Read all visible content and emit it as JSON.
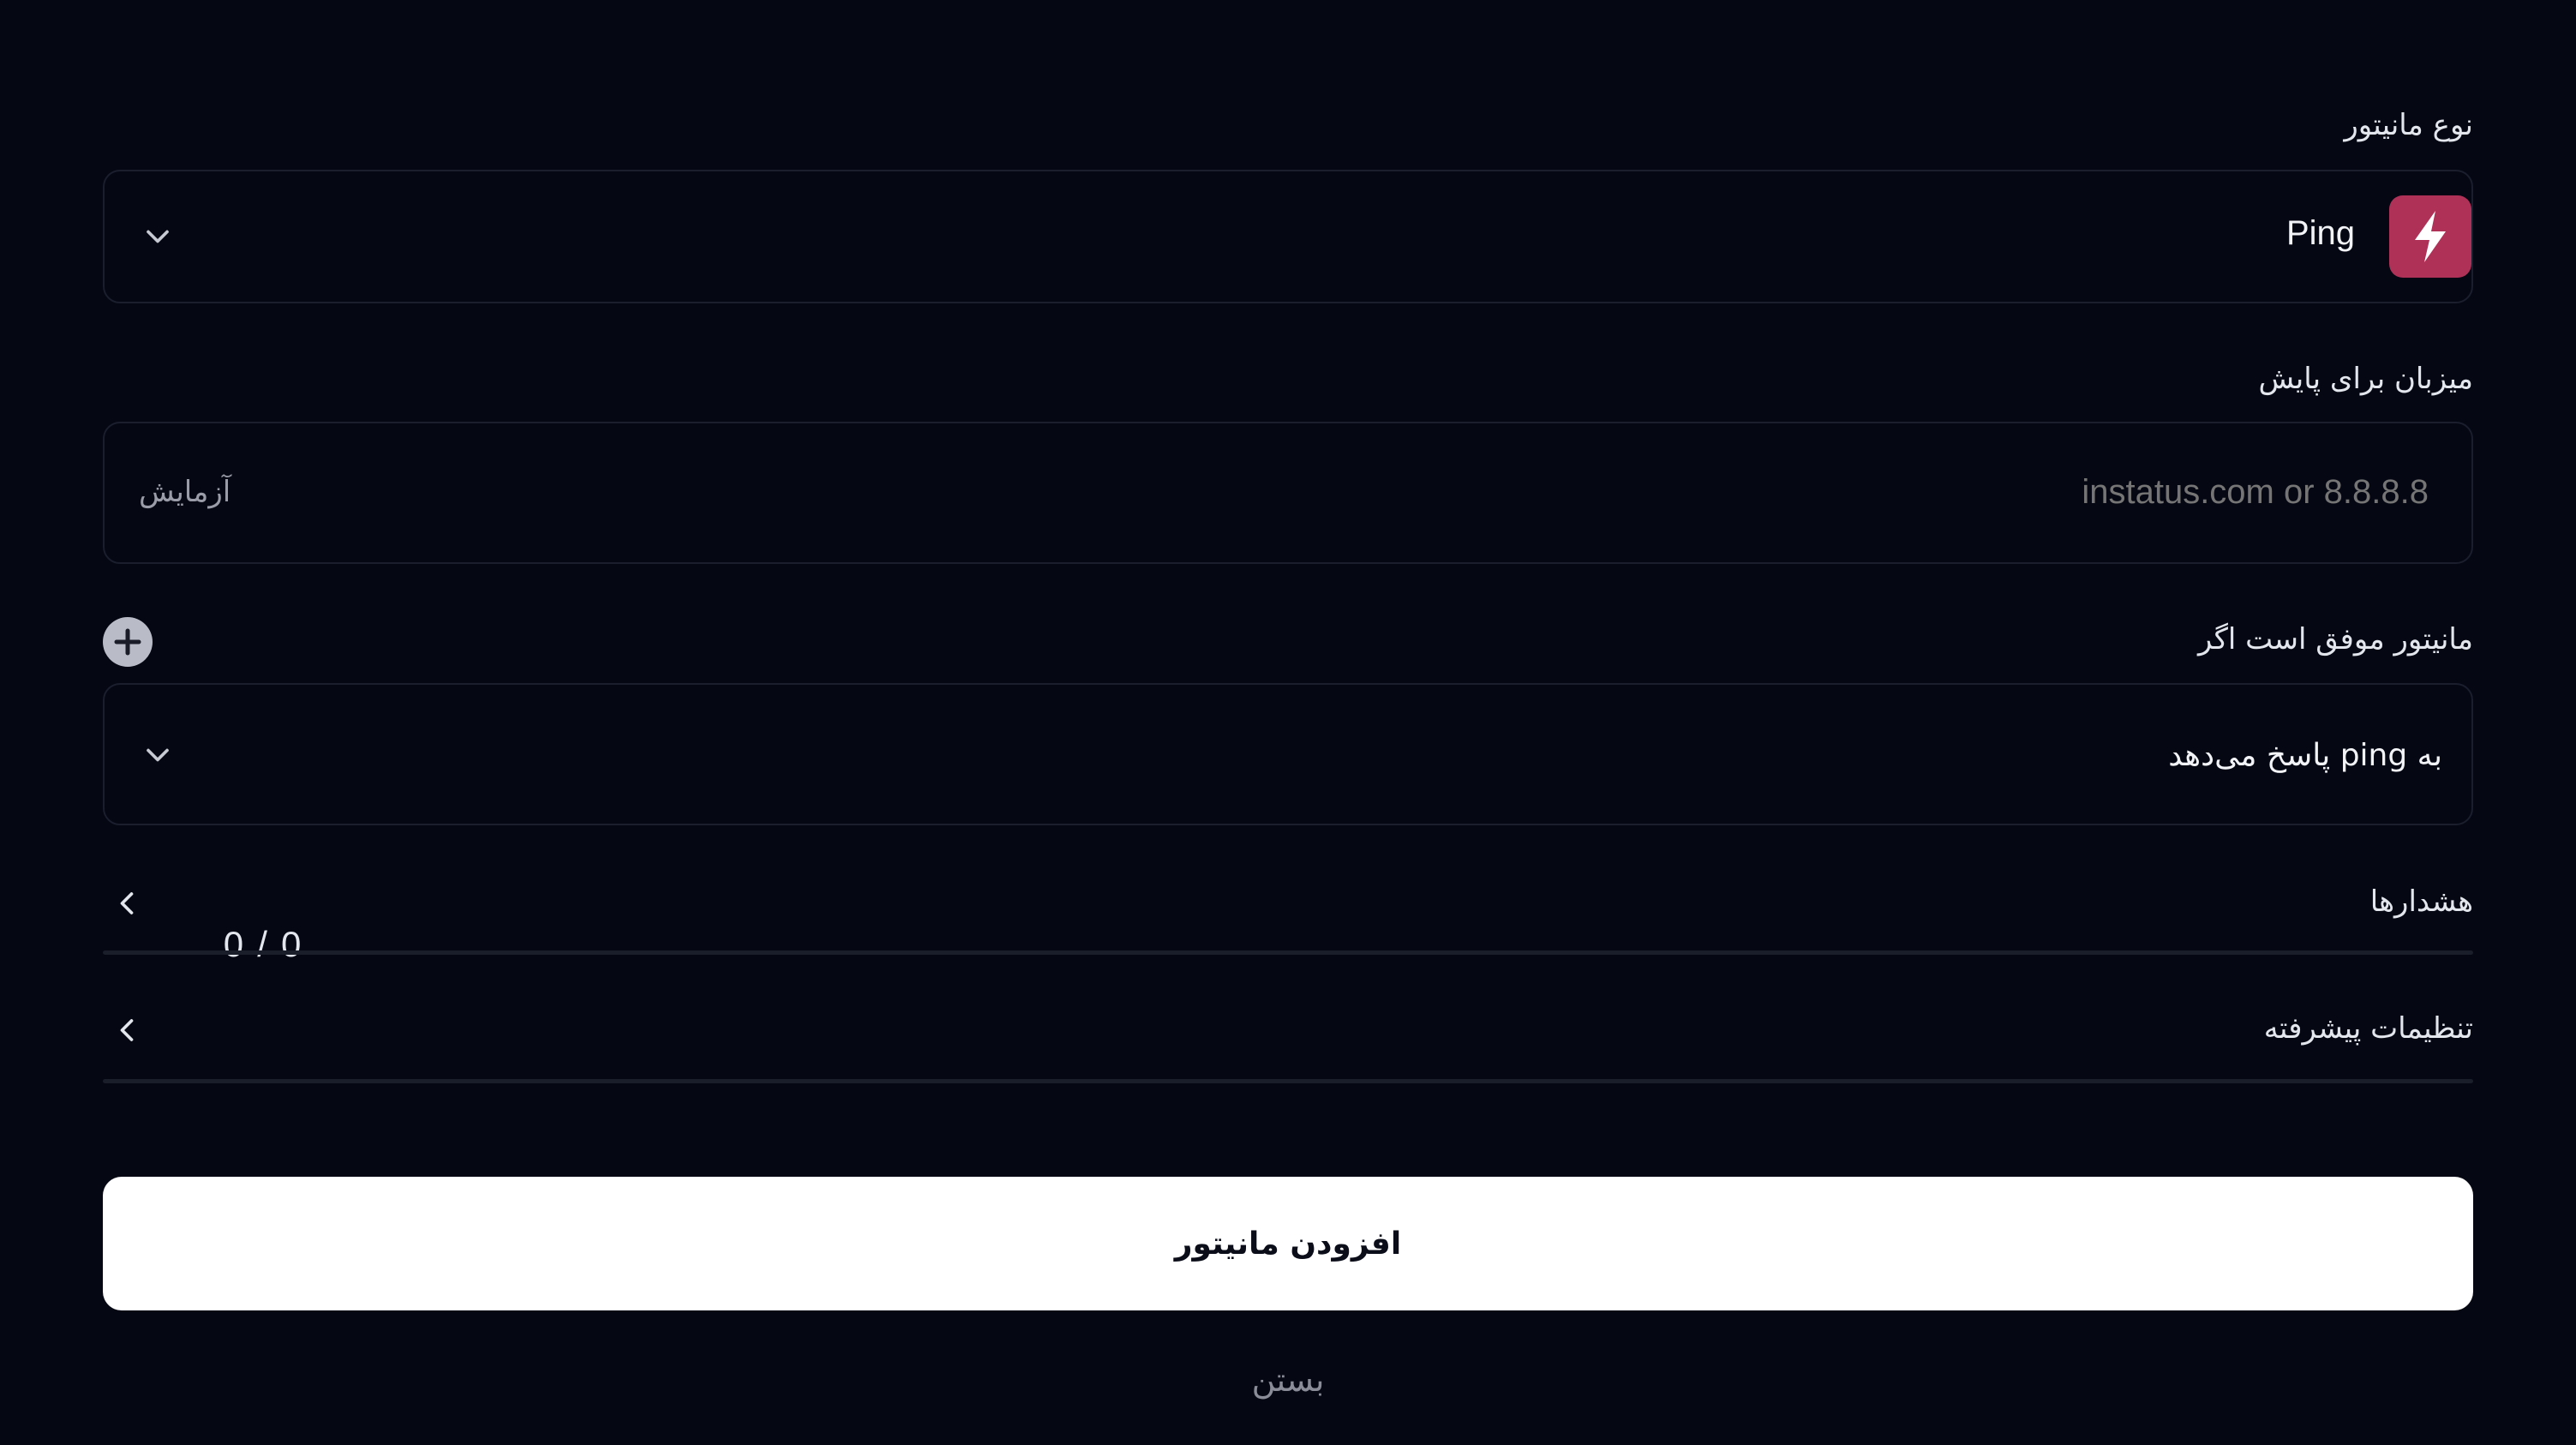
{
  "monitor_type": {
    "label": "نوع مانیتور",
    "selected": "Ping",
    "icon": "lightning-icon",
    "icon_bg": "#b03158"
  },
  "host": {
    "label": "میزبان برای پایش",
    "placeholder": "instatus.com or 8.8.8.8",
    "test_label": "آزمایش"
  },
  "success_condition": {
    "label": "مانیتور موفق است اگر",
    "selected": "به ping پاسخ می‌دهد",
    "add_icon": "plus-circle-icon"
  },
  "alerts": {
    "label": "هشدارها",
    "count_a": "0",
    "separator": "/",
    "count_b": "0"
  },
  "advanced": {
    "label": "تنظیمات پیشرفته"
  },
  "actions": {
    "add_monitor": "افزودن مانیتور",
    "close": "بستن"
  },
  "colors": {
    "background": "#050713",
    "border": "#1a1e2d",
    "accent": "#b03158",
    "button_bg": "#ffffff"
  }
}
